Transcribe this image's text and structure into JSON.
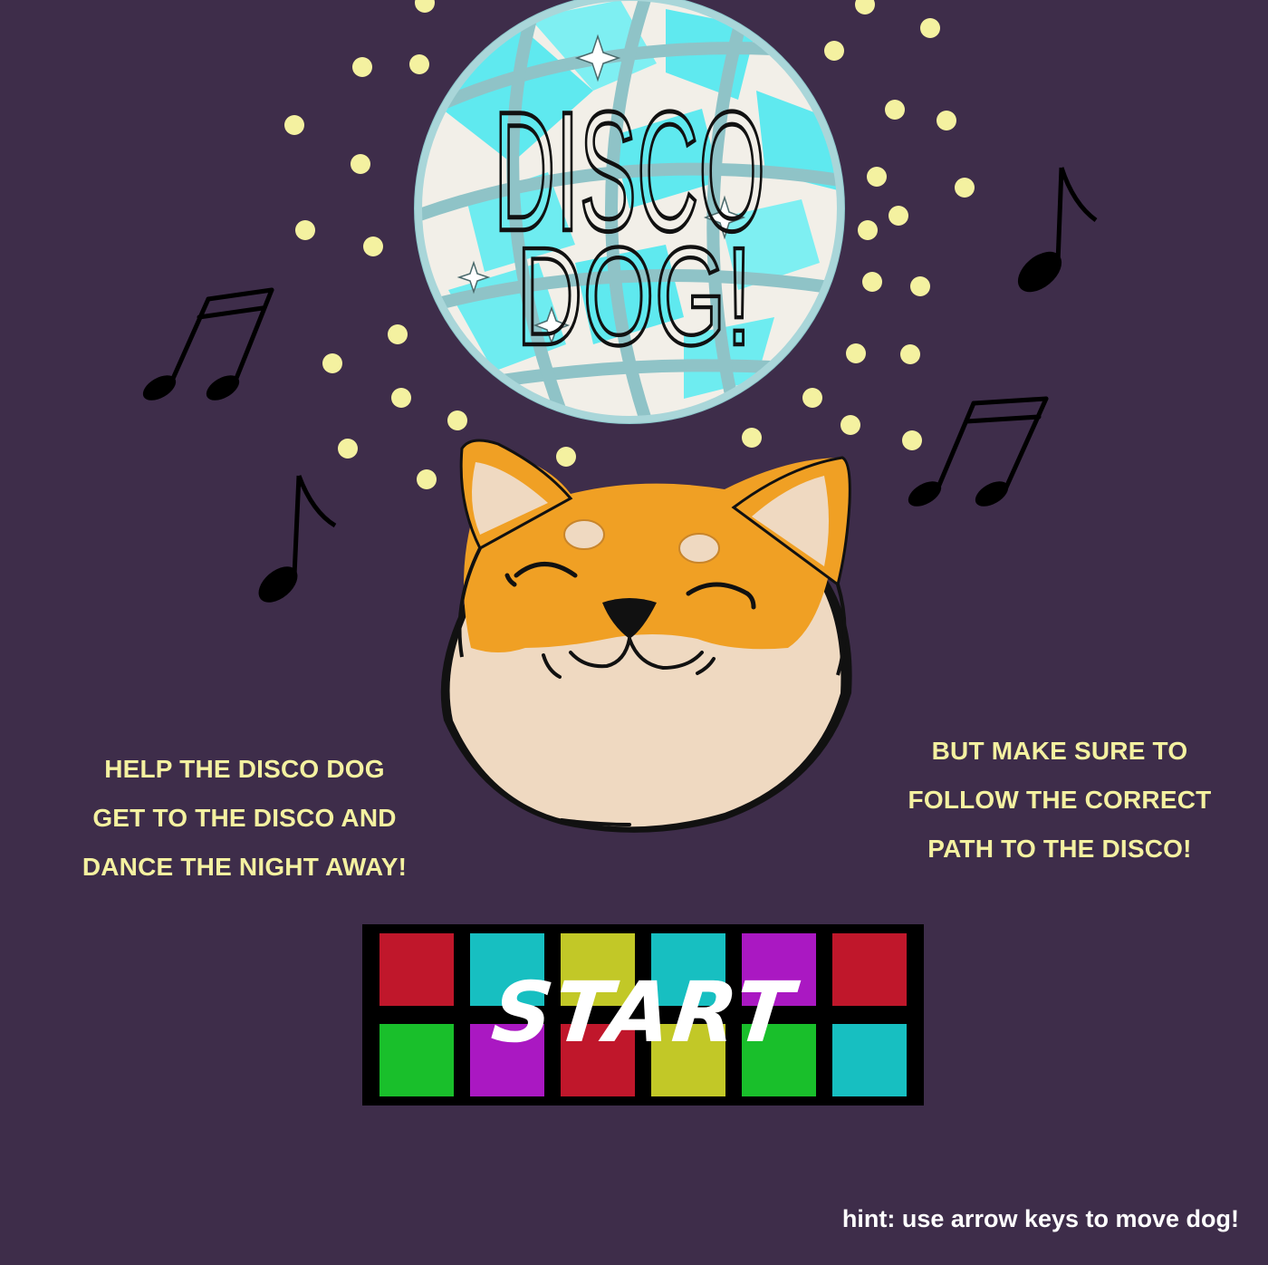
{
  "game": {
    "title_line1": "DISCO",
    "title_line2": "DOG!",
    "start_label": "START",
    "hint": "hint: use arrow keys to move dog!"
  },
  "instructions": {
    "left": [
      "HELP THE DISCO DOG",
      "GET TO THE DISCO AND",
      "DANCE THE NIGHT AWAY!"
    ],
    "right": [
      "BUT MAKE SURE TO",
      "FOLLOW THE CORRECT",
      "PATH TO THE DISCO!"
    ]
  },
  "colors": {
    "background": "#3e2d4a",
    "text_yellow": "#f4f1a0",
    "tile_red": "#c0172b",
    "tile_teal": "#17bfc1",
    "tile_olive": "#c2c827",
    "tile_purple": "#aa18c2",
    "tile_green": "#19bf2b"
  },
  "start_tiles": [
    [
      "red",
      "teal",
      "olive",
      "teal",
      "purple",
      "red"
    ],
    [
      "green",
      "purple",
      "red",
      "olive",
      "green",
      "teal"
    ]
  ]
}
